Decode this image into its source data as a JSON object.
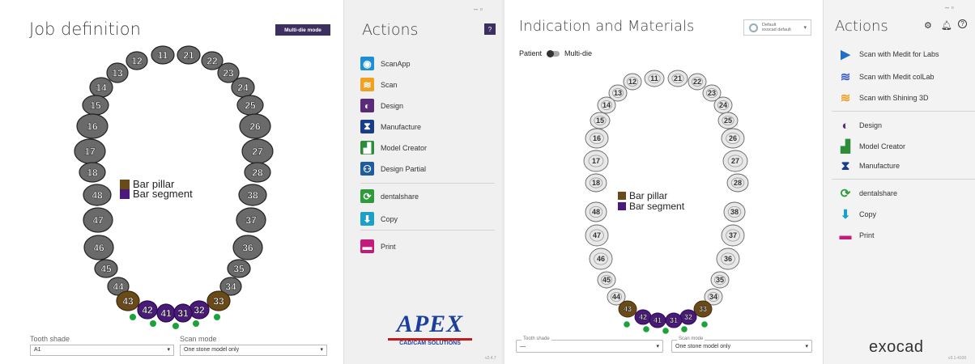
{
  "panel1": {
    "title": "Job definition",
    "multidie_button": "Multi-die mode",
    "tooth_numbers_upper": [
      "11",
      "21",
      "12",
      "22",
      "13",
      "23",
      "14",
      "24",
      "15",
      "25",
      "16",
      "26",
      "17",
      "27",
      "18",
      "28"
    ],
    "tooth_numbers_lower": [
      "48",
      "38",
      "47",
      "37",
      "46",
      "36",
      "45",
      "35",
      "44",
      "34",
      "43",
      "33",
      "42",
      "32",
      "41",
      "31"
    ],
    "legend": {
      "pillar": "Bar pillar",
      "segment": "Bar segment"
    },
    "tooth_shade_label": "Tooth shade",
    "tooth_shade_value": "A1",
    "scan_mode_label": "Scan mode",
    "scan_mode_value": "One stone model only"
  },
  "panel2": {
    "title": "Actions",
    "help": "?",
    "winctl": "– ▫",
    "items": [
      {
        "label": "ScanApp",
        "color": "#1c8fd6",
        "icon": "scanapp-icon"
      },
      {
        "label": "Scan",
        "color": "#f0a023",
        "icon": "scan-icon"
      },
      {
        "label": "Design",
        "color": "#5a2b7a",
        "icon": "design-icon"
      },
      {
        "label": "Manufacture",
        "color": "#1a3d8a",
        "icon": "manufacture-icon"
      },
      {
        "label": "Model Creator",
        "color": "#2e8b3a",
        "icon": "model-creator-icon"
      },
      {
        "label": "Design Partial",
        "color": "#1e5c9e",
        "icon": "design-partial-icon"
      },
      {
        "label": "dentalshare",
        "color": "#2e9a3a",
        "icon": "dentalshare-icon"
      },
      {
        "label": "Copy",
        "color": "#1ba0c8",
        "icon": "copy-icon"
      },
      {
        "label": "Print",
        "color": "#c41a7a",
        "icon": "print-icon"
      }
    ],
    "logo": "APEX",
    "logo_sub": "CAD/CAM SOLUTIONS",
    "version": "v2.4.7"
  },
  "panel3": {
    "title": "Indication and Materials",
    "dropdown_line1": "Default",
    "dropdown_line2": "exocad default",
    "toggle_left": "Patient",
    "toggle_right": "Multi-die",
    "legend": {
      "pillar": "Bar pillar",
      "segment": "Bar segment"
    },
    "tooth_shade_label": "Tooth shade",
    "tooth_shade_value": "—",
    "scan_mode_label": "Scan mode",
    "scan_mode_value": "One stone model only"
  },
  "panel4": {
    "title": "Actions",
    "winctl": "– ▫",
    "items": [
      {
        "label": "Scan with Medit for Labs",
        "color": "#1f6fc4",
        "icon": "medit-icon"
      },
      {
        "label": "Scan with Medit colLab",
        "color": "#3a5fcf",
        "icon": "medit-collab-icon"
      },
      {
        "label": "Scan with Shining 3D",
        "color": "#f0a023",
        "icon": "shining3d-icon"
      },
      {
        "label": "Design",
        "color": "#5a2b7a",
        "icon": "design-icon"
      },
      {
        "label": "Model Creator",
        "color": "#2e8b3a",
        "icon": "model-creator-icon"
      },
      {
        "label": "Manufacture",
        "color": "#1a3d8a",
        "icon": "manufacture-icon"
      },
      {
        "label": "dentalshare",
        "color": "#2e9a3a",
        "icon": "dentalshare-icon"
      },
      {
        "label": "Copy",
        "color": "#1ba0c8",
        "icon": "copy-icon"
      },
      {
        "label": "Print",
        "color": "#c41a7a",
        "icon": "print-icon"
      }
    ],
    "logo": "exocad",
    "version": "v3.1-4100"
  },
  "colors": {
    "pillar": "#6b4a1a",
    "segment": "#4a1a7a",
    "dot": "#1aa33a"
  }
}
